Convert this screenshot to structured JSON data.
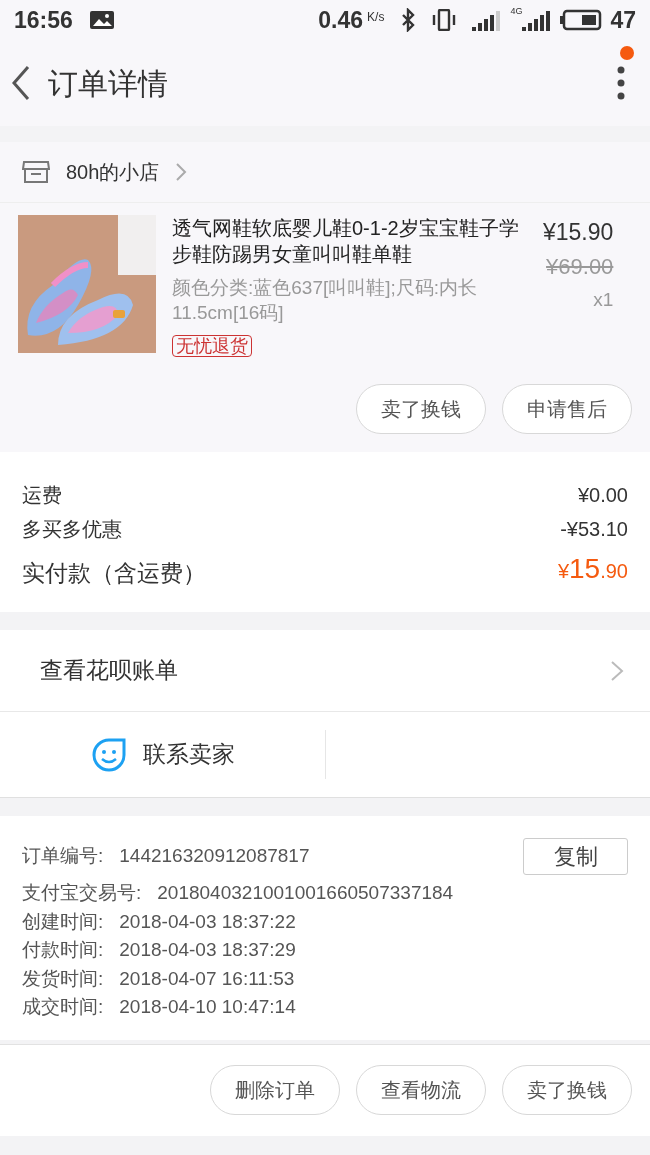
{
  "status_bar": {
    "time": "16:56",
    "speed": "0.46",
    "speed_unit": "K/s",
    "network": "4G",
    "battery": "47"
  },
  "header": {
    "title": "订单详情",
    "notification": true
  },
  "shop": {
    "name": "80h的小店"
  },
  "product": {
    "title": "透气网鞋软底婴儿鞋0-1-2岁宝宝鞋子学步鞋防踢男女童叫叫鞋单鞋",
    "price": "¥15.90",
    "original_price": "¥69.00",
    "spec": "颜色分类:蓝色637[叫叫鞋];尺码:内长11.5cm[16码]",
    "quantity": "x1",
    "tag": "无忧退货"
  },
  "product_actions": [
    "卖了换钱",
    "申请售后"
  ],
  "fees": [
    {
      "label": "运费",
      "value": "¥0.00"
    },
    {
      "label": "多买多优惠",
      "value": "-¥53.10"
    }
  ],
  "total": {
    "label": "实付款（含运费）",
    "currency": "¥",
    "integer": "15",
    "decimal": ".90"
  },
  "huabei": {
    "label": "查看花呗账单"
  },
  "contact": {
    "label": "联系卖家"
  },
  "order_info": {
    "copy_button": "复制",
    "rows": [
      {
        "label": "订单编号:",
        "value": "144216320912087817"
      },
      {
        "label": "支付宝交易号:",
        "value": "2018040321001001660507337184"
      },
      {
        "label": "创建时间:",
        "value": "2018-04-03 18:37:22"
      },
      {
        "label": "付款时间:",
        "value": "2018-04-03 18:37:29"
      },
      {
        "label": "发货时间:",
        "value": "2018-04-07 16:11:53"
      },
      {
        "label": "成交时间:",
        "value": "2018-04-10 10:47:14"
      }
    ]
  },
  "bottom_actions": [
    "删除订单",
    "查看物流",
    "卖了换钱"
  ]
}
